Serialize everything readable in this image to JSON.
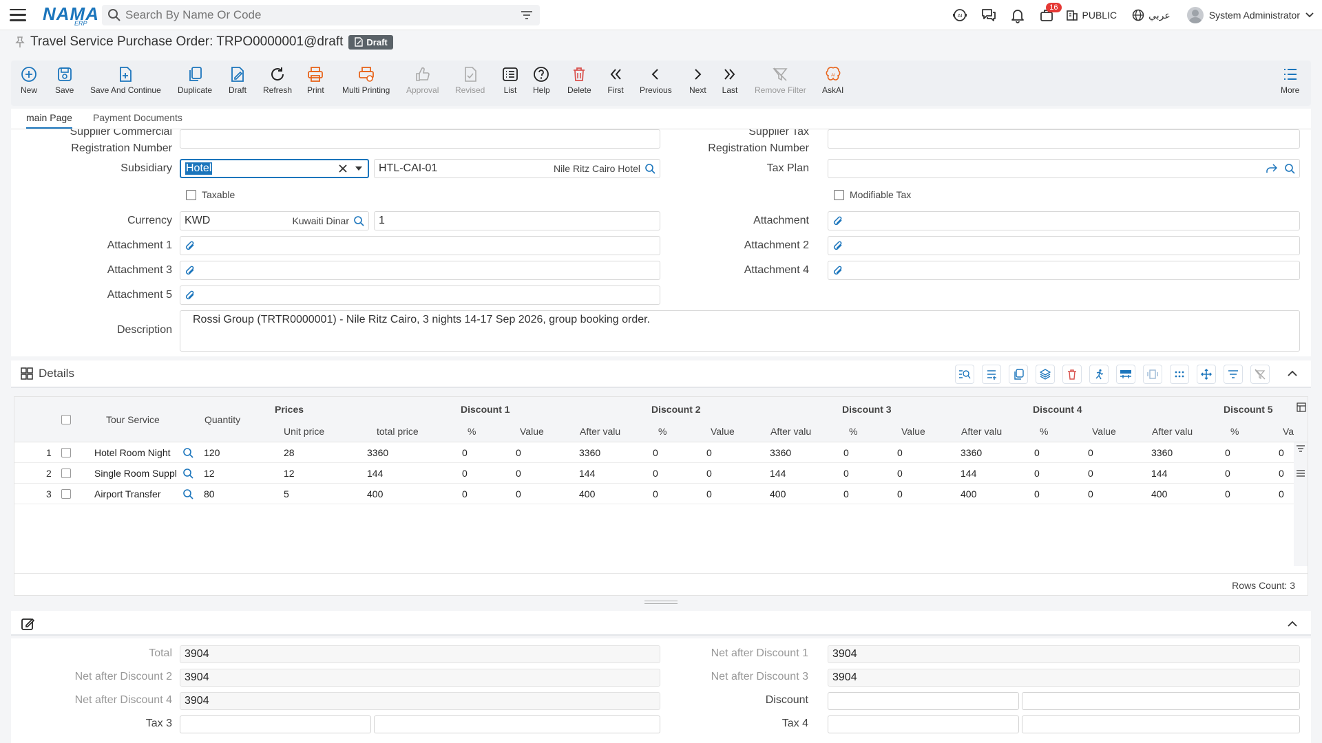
{
  "app": {
    "logo_text": "NAMA",
    "logo_sub": "ERP",
    "search_placeholder": "Search By Name Or Code",
    "notification_count": "16",
    "public_label": "PUBLIC",
    "language_label": "عربي",
    "user_name": "System Administrator"
  },
  "page": {
    "title": "Travel Service Purchase Order: TRPO0000001@draft",
    "status_badge": "Draft"
  },
  "toolbar": {
    "new": "New",
    "save": "Save",
    "save_continue": "Save And Continue",
    "duplicate": "Duplicate",
    "draft": "Draft",
    "refresh": "Refresh",
    "print": "Print",
    "multi_printing": "Multi Printing",
    "approval": "Approval",
    "revised": "Revised",
    "list": "List",
    "help": "Help",
    "delete": "Delete",
    "first": "First",
    "previous": "Previous",
    "next": "Next",
    "last": "Last",
    "remove_filter": "Remove Filter",
    "askai": "AskAI",
    "more": "More"
  },
  "tabs": [
    "main Page",
    "Payment Documents"
  ],
  "form": {
    "supplier_cr_label": "Supplier Commercial Registration Number",
    "supplier_tax_label": "Supplier Tax Registration Number",
    "subsidiary_label": "Subsidiary",
    "subsidiary_value": "Hotel",
    "subsidiary_code": "HTL-CAI-01",
    "subsidiary_name": "Nile Ritz Cairo Hotel",
    "tax_plan_label": "Tax Plan",
    "taxable_label": "Taxable",
    "modifiable_tax_label": "Modifiable Tax",
    "currency_label": "Currency",
    "currency_code": "KWD",
    "currency_name": "Kuwaiti Dinar",
    "currency_rate": "1",
    "attachment_label": "Attachment",
    "attachment1_label": "Attachment 1",
    "attachment2_label": "Attachment 2",
    "attachment3_label": "Attachment 3",
    "attachment4_label": "Attachment 4",
    "attachment5_label": "Attachment 5",
    "description_label": "Description",
    "description_value": "Rossi Group (TRTR0000001) - Nile Ritz Cairo, 3 nights 14-17 Sep 2026, group booking order."
  },
  "details": {
    "title": "Details",
    "headers": {
      "tour_service": "Tour Service",
      "quantity": "Quantity",
      "prices": "Prices",
      "unit_price": "Unit price",
      "total_price": "total price",
      "discount1": "Discount 1",
      "discount2": "Discount 2",
      "discount3": "Discount 3",
      "discount4": "Discount 4",
      "discount5": "Discount 5",
      "pct": "%",
      "value": "Value",
      "after_value": "After valu",
      "va": "Va"
    },
    "rows": [
      {
        "num": "1",
        "service": "Hotel Room Night",
        "qty": "120",
        "unit": "28",
        "total": "3360",
        "d1p": "0",
        "d1v": "0",
        "d1a": "3360",
        "d2p": "0",
        "d2v": "0",
        "d2a": "3360",
        "d3p": "0",
        "d3v": "0",
        "d3a": "3360",
        "d4p": "0",
        "d4v": "0",
        "d4a": "3360",
        "d5p": "0",
        "d5v": "0"
      },
      {
        "num": "2",
        "service": "Single Room Suppl",
        "qty": "12",
        "unit": "12",
        "total": "144",
        "d1p": "0",
        "d1v": "0",
        "d1a": "144",
        "d2p": "0",
        "d2v": "0",
        "d2a": "144",
        "d3p": "0",
        "d3v": "0",
        "d3a": "144",
        "d4p": "0",
        "d4v": "0",
        "d4a": "144",
        "d5p": "0",
        "d5v": "0"
      },
      {
        "num": "3",
        "service": "Airport Transfer",
        "qty": "80",
        "unit": "5",
        "total": "400",
        "d1p": "0",
        "d1v": "0",
        "d1a": "400",
        "d2p": "0",
        "d2v": "0",
        "d2a": "400",
        "d3p": "0",
        "d3v": "0",
        "d3a": "400",
        "d4p": "0",
        "d4v": "0",
        "d4a": "400",
        "d5p": "0",
        "d5v": "0"
      }
    ],
    "rows_count": "Rows Count: 3"
  },
  "totals": {
    "total_label": "Total",
    "total_value": "3904",
    "nad1_label": "Net after Discount 1",
    "nad1_value": "3904",
    "nad2_label": "Net after Discount 2",
    "nad2_value": "3904",
    "nad3_label": "Net after Discount 3",
    "nad3_value": "3904",
    "nad4_label": "Net after Discount 4",
    "nad4_value": "3904",
    "discount_label": "Discount",
    "tax3_label": "Tax 3",
    "tax4_label": "Tax 4"
  },
  "colors": {
    "accent": "#1b75bc",
    "danger": "#d9534f",
    "badge": "#5a6268"
  }
}
